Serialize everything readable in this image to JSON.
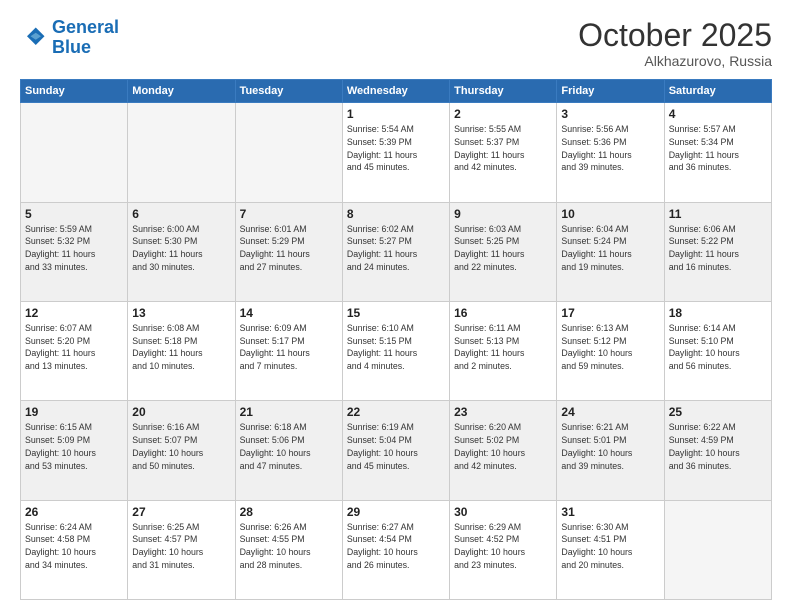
{
  "header": {
    "logo_line1": "General",
    "logo_line2": "Blue",
    "month": "October 2025",
    "location": "Alkhazurovo, Russia"
  },
  "weekdays": [
    "Sunday",
    "Monday",
    "Tuesday",
    "Wednesday",
    "Thursday",
    "Friday",
    "Saturday"
  ],
  "weeks": [
    [
      {
        "day": "",
        "info": ""
      },
      {
        "day": "",
        "info": ""
      },
      {
        "day": "",
        "info": ""
      },
      {
        "day": "1",
        "info": "Sunrise: 5:54 AM\nSunset: 5:39 PM\nDaylight: 11 hours\nand 45 minutes."
      },
      {
        "day": "2",
        "info": "Sunrise: 5:55 AM\nSunset: 5:37 PM\nDaylight: 11 hours\nand 42 minutes."
      },
      {
        "day": "3",
        "info": "Sunrise: 5:56 AM\nSunset: 5:36 PM\nDaylight: 11 hours\nand 39 minutes."
      },
      {
        "day": "4",
        "info": "Sunrise: 5:57 AM\nSunset: 5:34 PM\nDaylight: 11 hours\nand 36 minutes."
      }
    ],
    [
      {
        "day": "5",
        "info": "Sunrise: 5:59 AM\nSunset: 5:32 PM\nDaylight: 11 hours\nand 33 minutes."
      },
      {
        "day": "6",
        "info": "Sunrise: 6:00 AM\nSunset: 5:30 PM\nDaylight: 11 hours\nand 30 minutes."
      },
      {
        "day": "7",
        "info": "Sunrise: 6:01 AM\nSunset: 5:29 PM\nDaylight: 11 hours\nand 27 minutes."
      },
      {
        "day": "8",
        "info": "Sunrise: 6:02 AM\nSunset: 5:27 PM\nDaylight: 11 hours\nand 24 minutes."
      },
      {
        "day": "9",
        "info": "Sunrise: 6:03 AM\nSunset: 5:25 PM\nDaylight: 11 hours\nand 22 minutes."
      },
      {
        "day": "10",
        "info": "Sunrise: 6:04 AM\nSunset: 5:24 PM\nDaylight: 11 hours\nand 19 minutes."
      },
      {
        "day": "11",
        "info": "Sunrise: 6:06 AM\nSunset: 5:22 PM\nDaylight: 11 hours\nand 16 minutes."
      }
    ],
    [
      {
        "day": "12",
        "info": "Sunrise: 6:07 AM\nSunset: 5:20 PM\nDaylight: 11 hours\nand 13 minutes."
      },
      {
        "day": "13",
        "info": "Sunrise: 6:08 AM\nSunset: 5:18 PM\nDaylight: 11 hours\nand 10 minutes."
      },
      {
        "day": "14",
        "info": "Sunrise: 6:09 AM\nSunset: 5:17 PM\nDaylight: 11 hours\nand 7 minutes."
      },
      {
        "day": "15",
        "info": "Sunrise: 6:10 AM\nSunset: 5:15 PM\nDaylight: 11 hours\nand 4 minutes."
      },
      {
        "day": "16",
        "info": "Sunrise: 6:11 AM\nSunset: 5:13 PM\nDaylight: 11 hours\nand 2 minutes."
      },
      {
        "day": "17",
        "info": "Sunrise: 6:13 AM\nSunset: 5:12 PM\nDaylight: 10 hours\nand 59 minutes."
      },
      {
        "day": "18",
        "info": "Sunrise: 6:14 AM\nSunset: 5:10 PM\nDaylight: 10 hours\nand 56 minutes."
      }
    ],
    [
      {
        "day": "19",
        "info": "Sunrise: 6:15 AM\nSunset: 5:09 PM\nDaylight: 10 hours\nand 53 minutes."
      },
      {
        "day": "20",
        "info": "Sunrise: 6:16 AM\nSunset: 5:07 PM\nDaylight: 10 hours\nand 50 minutes."
      },
      {
        "day": "21",
        "info": "Sunrise: 6:18 AM\nSunset: 5:06 PM\nDaylight: 10 hours\nand 47 minutes."
      },
      {
        "day": "22",
        "info": "Sunrise: 6:19 AM\nSunset: 5:04 PM\nDaylight: 10 hours\nand 45 minutes."
      },
      {
        "day": "23",
        "info": "Sunrise: 6:20 AM\nSunset: 5:02 PM\nDaylight: 10 hours\nand 42 minutes."
      },
      {
        "day": "24",
        "info": "Sunrise: 6:21 AM\nSunset: 5:01 PM\nDaylight: 10 hours\nand 39 minutes."
      },
      {
        "day": "25",
        "info": "Sunrise: 6:22 AM\nSunset: 4:59 PM\nDaylight: 10 hours\nand 36 minutes."
      }
    ],
    [
      {
        "day": "26",
        "info": "Sunrise: 6:24 AM\nSunset: 4:58 PM\nDaylight: 10 hours\nand 34 minutes."
      },
      {
        "day": "27",
        "info": "Sunrise: 6:25 AM\nSunset: 4:57 PM\nDaylight: 10 hours\nand 31 minutes."
      },
      {
        "day": "28",
        "info": "Sunrise: 6:26 AM\nSunset: 4:55 PM\nDaylight: 10 hours\nand 28 minutes."
      },
      {
        "day": "29",
        "info": "Sunrise: 6:27 AM\nSunset: 4:54 PM\nDaylight: 10 hours\nand 26 minutes."
      },
      {
        "day": "30",
        "info": "Sunrise: 6:29 AM\nSunset: 4:52 PM\nDaylight: 10 hours\nand 23 minutes."
      },
      {
        "day": "31",
        "info": "Sunrise: 6:30 AM\nSunset: 4:51 PM\nDaylight: 10 hours\nand 20 minutes."
      },
      {
        "day": "",
        "info": ""
      }
    ]
  ]
}
